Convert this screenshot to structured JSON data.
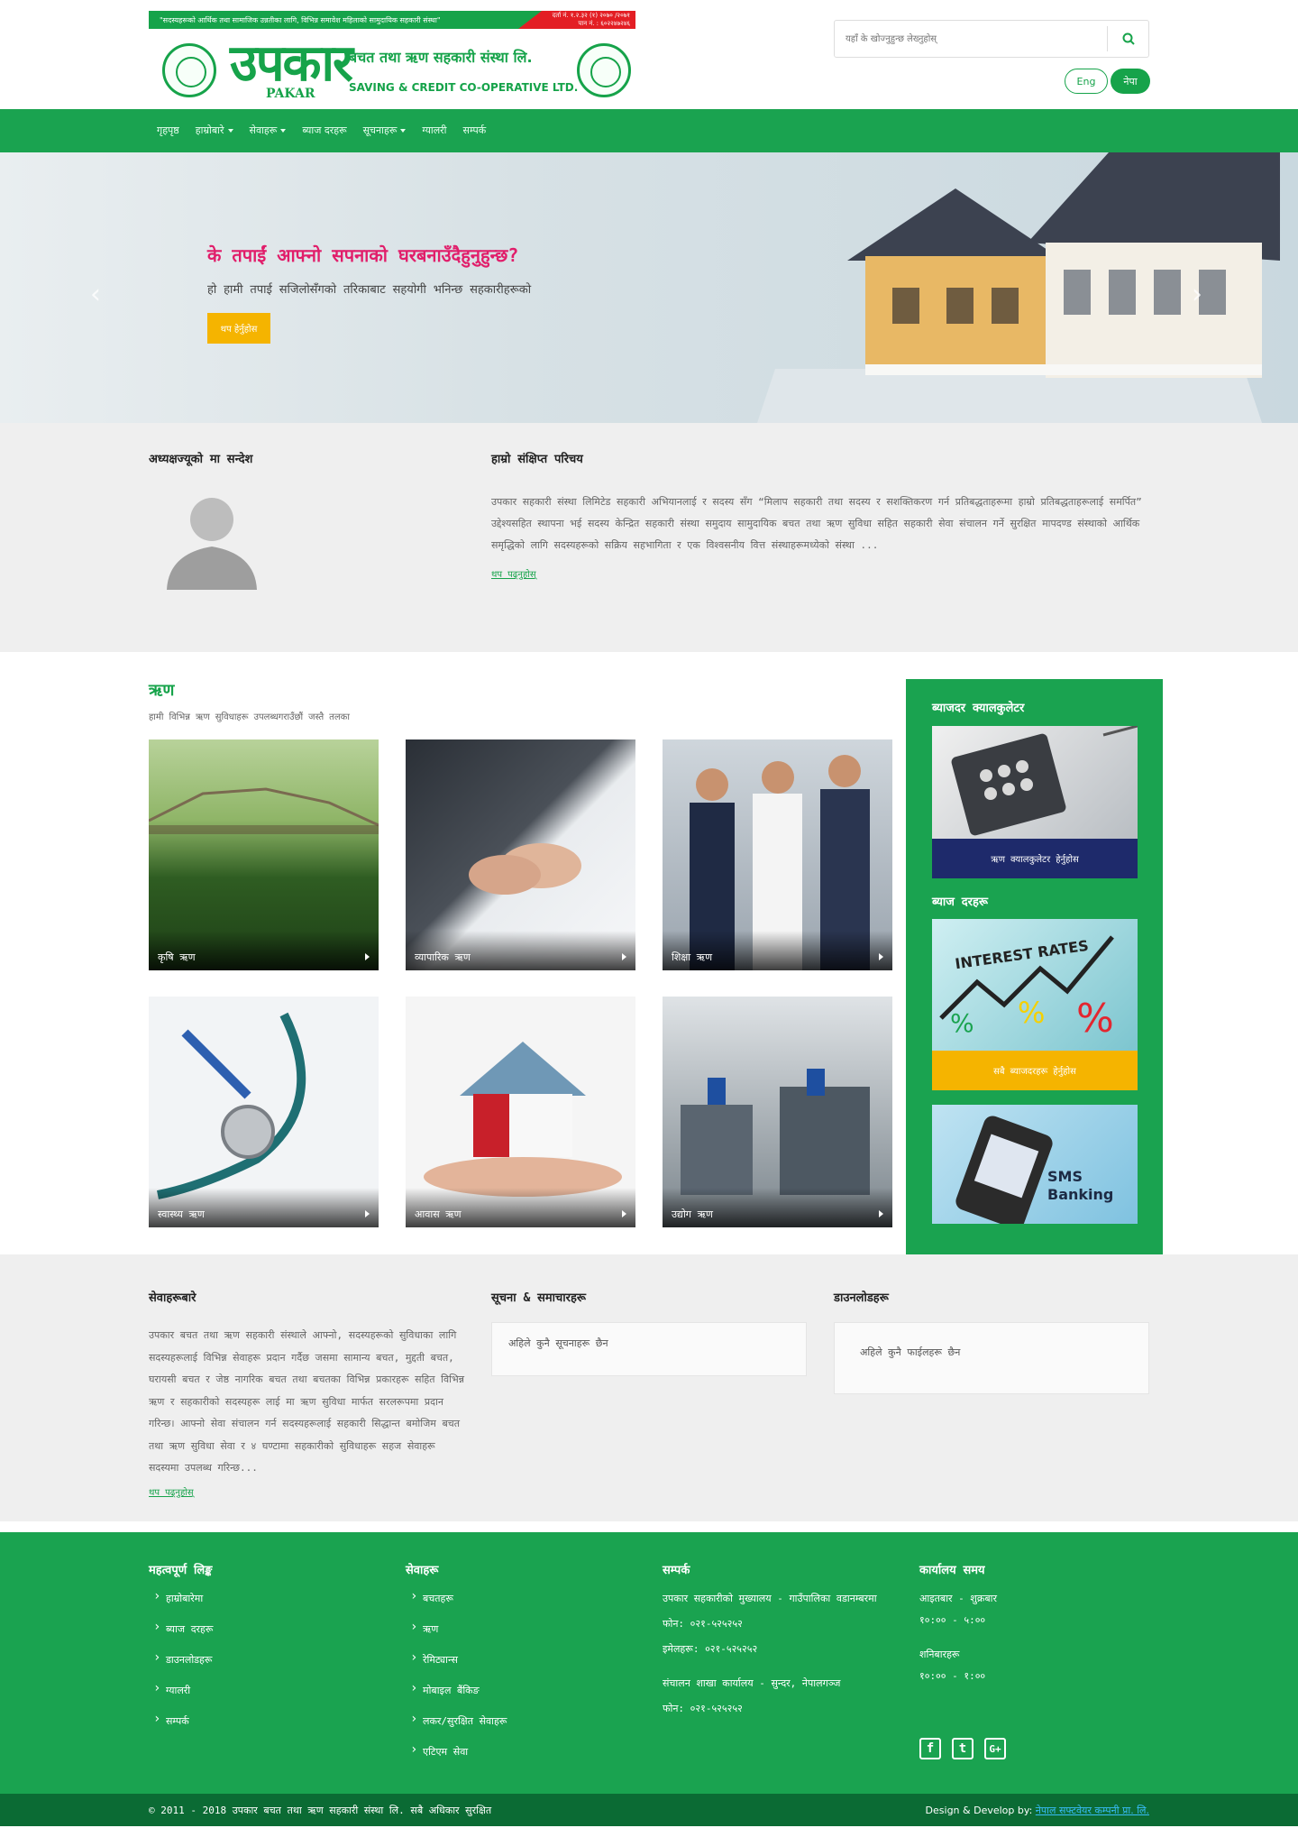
{
  "header": {
    "slogan": "\"सदस्यहरूको आर्थिक तथा सामाजिक उन्नतीका लागि, विभिन्न समावेश महिलाको सामुदायिक सहकारी संस्था\"",
    "reg_line1": "दर्ता नं. १.२.३२ (१) २०७० /२०७१",
    "reg_line2": "पान नं. : ६०२२४७२४६",
    "logo_text": "उपकार",
    "logo_text_en": "PAKAR",
    "logo_subtitle": "बचत तथा ऋण सहकारी संस्था लि.",
    "logo_english": "SAVING & CREDIT CO-OPERATIVE LTD.",
    "search_placeholder": "यहाँ के खोज्नुहुन्छ लेख्नुहोस्",
    "lang_eng": "Eng",
    "lang_nep": "नेपा"
  },
  "nav": {
    "items": [
      "गृहपृष्ठ",
      "हाम्रोबारे",
      "सेवाहरू",
      "ब्याज दरहरू",
      "सूचनाहरू",
      "ग्यालरी",
      "सम्पर्क"
    ]
  },
  "hero": {
    "title": "के तपाईं आफ्नो सपनाको घरबनाउँदैहुनुहुन्छ?",
    "text": "हो हामी तपाई सजिलोसँगको तरिकाबाट सहयोगी भनिन्छ सहकारीहरूको",
    "button": "थप हेर्नुहोस"
  },
  "about": {
    "chairman_title": "अध्यक्षज्यूको मा सन्देश",
    "about_title": "हाम्रो संक्षिप्त परिचय",
    "text": "उपकार सहकारी संस्था लिमिटेड सहकारी अभियानलाई र सदस्य सँग “मिलाप सहकारी तथा सदस्य र सशक्तिकरण गर्न प्रतिबद्धताहरूमा हाम्रो प्रतिबद्धताहरूलाई समर्पित” उद्देश्यसहित स्थापना भई सदस्य केन्द्रित सहकारी संस्था समुदाय सामुदायिक बचत तथा ऋण सुविधा सहित सहकारी सेवा संचालन गर्ने सुरक्षित मापदण्ड संस्थाको आर्थिक समृद्धिको लागि सदस्यहरूको सक्रिय सहभागिता र एक विश्वसनीय वित्त संस्थाहरूमध्येको संस्था ...",
    "read_more": "थप पढ्नुहोस्"
  },
  "loans": {
    "title": "ऋण",
    "subtitle": "हामी विभिन्न ऋण सुविधाहरू उपलब्धगराउँछौं जस्तै तलका",
    "items": [
      {
        "name": "कृषि ऋण"
      },
      {
        "name": "व्यापारिक ऋण"
      },
      {
        "name": "शिक्षा ऋण"
      },
      {
        "name": "स्वास्थ्य ऋण"
      },
      {
        "name": "आवास ऋण"
      },
      {
        "name": "उद्योग ऋण"
      }
    ]
  },
  "sidebar": {
    "calc_title": "ब्याजदर क्यालकुलेटर",
    "calc_button": "ऋण क्यालकुलेटर हेर्नुहोस",
    "rates_title": "ब्याज दरहरू",
    "rates_button": "सबै ब्याजदरहरू हेर्नुहोस",
    "sms_line1": "SMS",
    "sms_line2": "Banking",
    "interest_label": "INTEREST RATES"
  },
  "bottom": {
    "services_title": "सेवाहरूबारे",
    "services_text": "उपकार बचत तथा ऋण सहकारी संस्थाले आफ्नो, सदस्यहरूको सुविधाका लागि सदस्यहरूलाई विभिन्न सेवाहरू प्रदान गर्दैछ जसमा सामान्य बचत, मुद्दती बचत, घरायसी बचत र जेष्ठ नागरिक बचत तथा बचतका विभिन्न प्रकारहरू सहित विभिन्न ऋण र सहकारीको सदस्यहरू लाई मा ऋण सुविधा मार्फत सरलरूपमा प्रदान गरिन्छ। आफ्नो सेवा संचालन गर्न सदस्यहरूलाई सहकारी सिद्धान्त बमोजिम बचत तथा ऋण सुविधा सेवा र ४ घण्टामा सहकारीको सुविधाहरू सहज सेवाहरू सदस्यमा उपलब्ध गरिन्छ...",
    "services_more": "थप पढ्नुहोस्",
    "notice_title": "सूचना & समाचारहरू",
    "notice_text": "अहिले कुनै सूचनाहरू छैन",
    "downloads_title": "डाउनलोडहरू",
    "downloads_text": "अहिले कुनै फाईलहरू छैन"
  },
  "footer": {
    "quick_title": "महत्वपूर्ण लिङ्क",
    "quick_links": [
      "हाम्रोबारेमा",
      "ब्याज दरहरू",
      "डाउनलोडहरू",
      "ग्यालरी",
      "सम्पर्क"
    ],
    "services_title": "सेवाहरू",
    "services_links": [
      "बचतहरू",
      "ऋण",
      "रेमिट्यान्स",
      "मोबाइल बैंकिङ",
      "लकर/सुरक्षित सेवाहरू",
      "एटिएम सेवा"
    ],
    "contact_title": "सम्पर्क",
    "contact_lines": [
      "उपकार सहकारीको मुख्यालय - गाउँपालिका वडानम्बरमा",
      "फोन: ०२१-५२५२५२",
      "इमेलहरू: ०२१-५२५२५२",
      "संचालन शाखा कार्यालय - सुन्दर, नेपालगञ्ज",
      "फोन: ०२१-५२५२५२"
    ],
    "hours_title": "कार्यालय समय",
    "hours_lines": [
      "आइतबार - शुक्रबार",
      "१०:०० - ५:००",
      "शनिबारहरू",
      "१०:०० - १:००"
    ]
  },
  "copyright": {
    "left": "© 2011 - 2018 उपकार बचत तथा ऋण सहकारी संस्था लि. सबै अधिकार सुरक्षित",
    "credit_label": "Design & Develop by:",
    "credit_link": "नेपाल सफ्टवेयर कम्पनी प्रा. लि."
  },
  "colors": {
    "brand_green": "#1aa350",
    "accent_yellow": "#f5b400",
    "hero_title": "#e11d6a",
    "calc_bar": "#1e2a6b"
  }
}
